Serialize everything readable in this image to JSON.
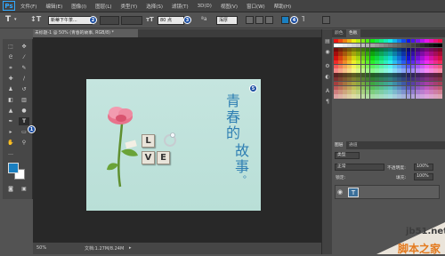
{
  "app": {
    "logo": "Ps"
  },
  "menu": [
    "文件(F)",
    "编辑(E)",
    "图像(I)",
    "图层(L)",
    "类型(Y)",
    "选择(S)",
    "滤镜(T)",
    "3D(D)",
    "视图(V)",
    "窗口(W)",
    "帮助(H)"
  ],
  "options": {
    "font_family": "新蒂下午茶...",
    "font_size": "80 点",
    "antialias": "浑厚",
    "markers": [
      "2",
      "3",
      "4"
    ]
  },
  "document": {
    "tab_title": "未标题-1 @ 50% (青春的故事, RGB/8) *",
    "canvas_marker": "5"
  },
  "artwork": {
    "tiles": [
      "L",
      "V",
      "E"
    ],
    "vertical_text_col1": [
      "青",
      "春",
      "的"
    ],
    "vertical_text_col2": [
      "故",
      "事",
      "。"
    ]
  },
  "tools": {
    "marker": "1"
  },
  "status": {
    "zoom": "50%",
    "doc_info": "文档:1.27M/8.24M"
  },
  "panels": {
    "color_tabs": [
      "颜色",
      "色板"
    ],
    "layer_tabs": [
      "图层",
      "通道"
    ],
    "filter_kind": "类型",
    "blend_mode": "正常",
    "opacity_label": "不透明度:",
    "opacity_value": "100%",
    "lock_label": "锁定:",
    "fill_label": "填充:",
    "fill_value": "100%"
  },
  "watermark": {
    "site": "jb51.net",
    "name": "脚本之家"
  },
  "colors": {
    "accent": "#31a8ff",
    "marker": "#1d4fa3",
    "foreground": "#1a7fc0",
    "background": "#ffffff",
    "text_art": "#2f7fb3"
  }
}
